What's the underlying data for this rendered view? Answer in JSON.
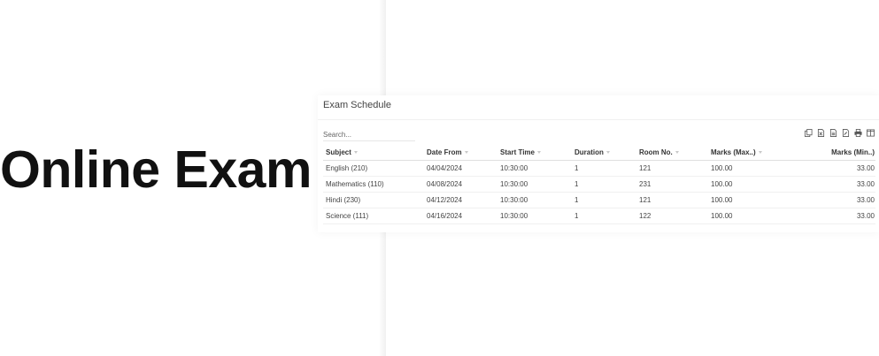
{
  "headline": "Online Exam",
  "schedule": {
    "title": "Exam Schedule",
    "search": {
      "placeholder": "Search...",
      "value": ""
    },
    "toolbar": [
      "copy-icon",
      "excel-icon",
      "csv-icon",
      "pdf-icon",
      "print-icon",
      "columns-icon"
    ],
    "columns": [
      "Subject",
      "Date From",
      "Start Time",
      "Duration",
      "Room No.",
      "Marks (Max..)",
      "Marks (Min..)"
    ],
    "rows": [
      [
        "English (210)",
        "04/04/2024",
        "10:30:00",
        "1",
        "121",
        "100.00",
        "33.00"
      ],
      [
        "Mathematics (110)",
        "04/08/2024",
        "10:30:00",
        "1",
        "231",
        "100.00",
        "33.00"
      ],
      [
        "Hindi (230)",
        "04/12/2024",
        "10:30:00",
        "1",
        "121",
        "100.00",
        "33.00"
      ],
      [
        "Science (111)",
        "04/16/2024",
        "10:30:00",
        "1",
        "122",
        "100.00",
        "33.00"
      ]
    ]
  },
  "colors": {
    "headline": "#111111",
    "text": "#444444",
    "border": "#e0e0e0"
  }
}
